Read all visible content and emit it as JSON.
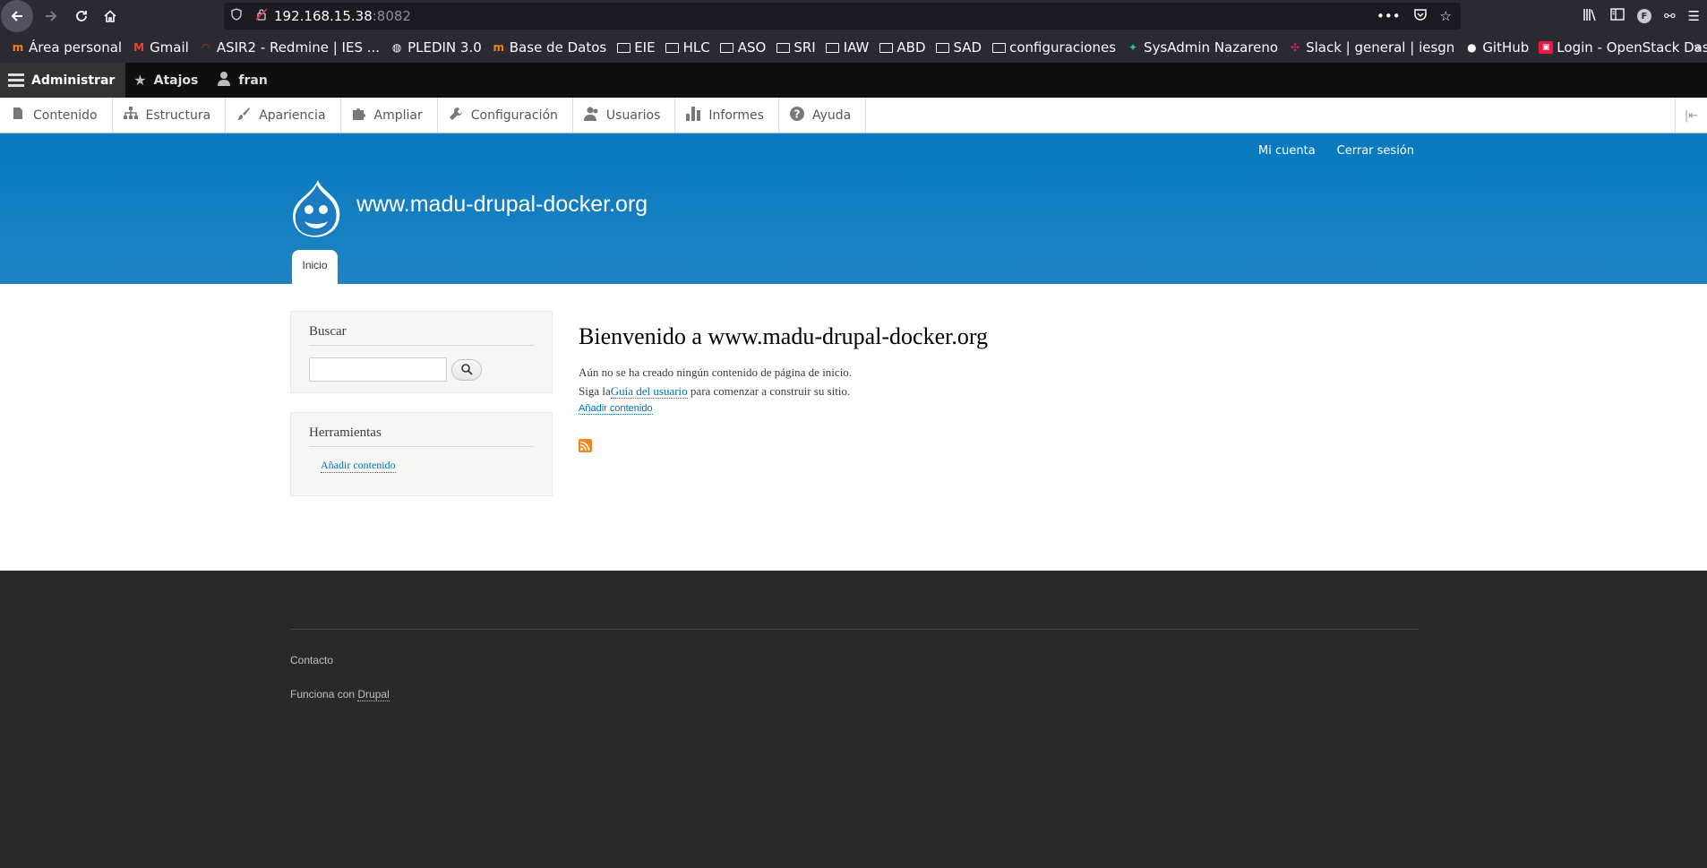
{
  "browser": {
    "url_host": "192.168.15.38",
    "url_port": ":8082",
    "bookmarks": [
      {
        "label": "Área personal",
        "icon": "moodle-icon"
      },
      {
        "label": "Gmail",
        "icon": "gmail-icon"
      },
      {
        "label": "ASIR2 - Redmine | IES ...",
        "icon": "redmine-icon"
      },
      {
        "label": "PLEDIN 3.0",
        "icon": "globe-icon"
      },
      {
        "label": "Base de Datos",
        "icon": "moodle-icon"
      },
      {
        "label": "EIE",
        "icon": "folder-icon"
      },
      {
        "label": "HLC",
        "icon": "folder-icon"
      },
      {
        "label": "ASO",
        "icon": "folder-icon"
      },
      {
        "label": "SRI",
        "icon": "folder-icon"
      },
      {
        "label": "IAW",
        "icon": "folder-icon"
      },
      {
        "label": "ABD",
        "icon": "folder-icon"
      },
      {
        "label": "SAD",
        "icon": "folder-icon"
      },
      {
        "label": "configuraciones",
        "icon": "folder-icon"
      },
      {
        "label": "SysAdmin Nazareno",
        "icon": "sysadmin-icon"
      },
      {
        "label": "Slack | general | iesgn",
        "icon": "slack-icon"
      },
      {
        "label": "GitHub",
        "icon": "github-icon"
      },
      {
        "label": "Login - OpenStack Das...",
        "icon": "openstack-icon"
      }
    ],
    "profile_initial": "F"
  },
  "admin_toolbar": {
    "manage": "Administrar",
    "shortcuts": "Atajos",
    "user": "fran"
  },
  "admin_tray": {
    "items": [
      {
        "label": "Contenido",
        "icon": "file-icon"
      },
      {
        "label": "Estructura",
        "icon": "sitemap-icon"
      },
      {
        "label": "Apariencia",
        "icon": "paintbrush-icon"
      },
      {
        "label": "Ampliar",
        "icon": "puzzle-icon"
      },
      {
        "label": "Configuración",
        "icon": "wrench-icon"
      },
      {
        "label": "Usuarios",
        "icon": "people-icon"
      },
      {
        "label": "Informes",
        "icon": "bar-chart-icon"
      },
      {
        "label": "Ayuda",
        "icon": "help-icon"
      }
    ]
  },
  "header": {
    "secondary_menu": [
      "Mi cuenta",
      "Cerrar sesión"
    ],
    "site_name": "www.madu-drupal-docker.org",
    "main_tab": "Inicio",
    "header_color": "#0779bf"
  },
  "sidebar": {
    "search_title": "Buscar",
    "tools_title": "Herramientas",
    "tools_link": "Añadir contenido"
  },
  "content": {
    "title": "Bienvenido a www.madu-drupal-docker.org",
    "p1": "Aún no se ha creado ningún contenido de página de inicio.",
    "p2_before": "Siga la",
    "p2_link": "Guía del usuario",
    "p2_after": " para comenzar a construir su sitio.",
    "add_link": "Añadir contenido"
  },
  "footer": {
    "contact": "Contacto",
    "powered_by": "Funciona con ",
    "powered_link": "Drupal"
  }
}
